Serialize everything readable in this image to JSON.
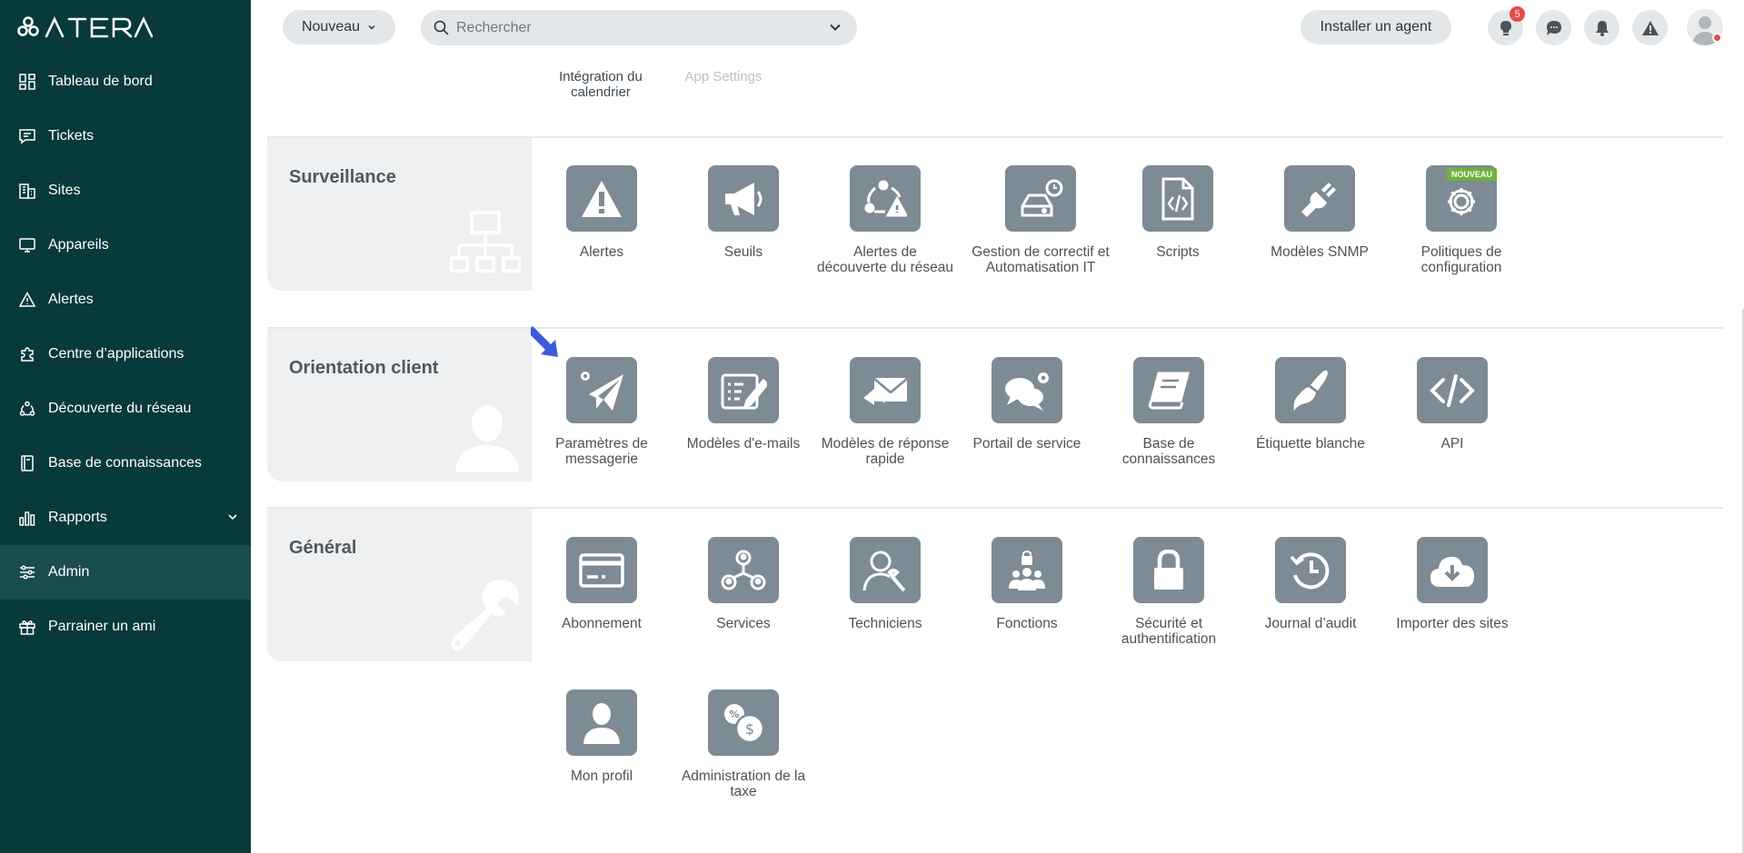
{
  "app": {
    "brand": "ATERA"
  },
  "sidebar": {
    "items": [
      {
        "label": "Tableau de bord",
        "icon": "dashboard-icon"
      },
      {
        "label": "Tickets",
        "icon": "ticket-icon"
      },
      {
        "label": "Sites",
        "icon": "building-icon"
      },
      {
        "label": "Appareils",
        "icon": "monitor-icon"
      },
      {
        "label": "Alertes",
        "icon": "warning-icon"
      },
      {
        "label": "Centre d’applications",
        "icon": "puzzle-icon"
      },
      {
        "label": "Découverte du réseau",
        "icon": "network-icon"
      },
      {
        "label": "Base de connaissances",
        "icon": "book-icon"
      },
      {
        "label": "Rapports",
        "icon": "chart-icon"
      },
      {
        "label": "Admin",
        "icon": "sliders-icon"
      },
      {
        "label": "Parrainer un ami",
        "icon": "gift-icon"
      }
    ]
  },
  "topbar": {
    "new_label": "Nouveau",
    "search_placeholder": "Rechercher",
    "install_agent_label": "Installer un agent",
    "ideas_badge": "5"
  },
  "top_links": {
    "calendar": "Intégration du calendrier",
    "app_settings": "App Settings"
  },
  "sections": {
    "surveillance": {
      "title": "Surveillance",
      "tiles": [
        {
          "label": "Alertes",
          "icon": "warning-icon"
        },
        {
          "label": "Seuils",
          "icon": "megaphone-icon"
        },
        {
          "label": "Alertes de découverte du réseau",
          "icon": "network-alert-icon"
        },
        {
          "label": "Gestion de correctif et Automatisation IT",
          "icon": "patch-icon"
        },
        {
          "label": "Scripts",
          "icon": "script-icon"
        },
        {
          "label": "Modèles SNMP",
          "icon": "plug-icon"
        },
        {
          "label": "Politiques de configuration",
          "icon": "gear-icon",
          "tag": "NOUVEAU"
        }
      ]
    },
    "orientation": {
      "title": "Orientation client",
      "tiles": [
        {
          "label": "Paramètres de messagerie",
          "icon": "send-settings-icon"
        },
        {
          "label": "Modèles d'e-mails",
          "icon": "email-template-icon"
        },
        {
          "label": "Modèles de réponse rapide",
          "icon": "quick-reply-icon"
        },
        {
          "label": "Portail de service",
          "icon": "chat-settings-icon"
        },
        {
          "label": "Base de connaissances",
          "icon": "book-icon"
        },
        {
          "label": "Étiquette blanche",
          "icon": "brush-icon"
        },
        {
          "label": "API",
          "icon": "code-icon"
        }
      ]
    },
    "general": {
      "title": "Général",
      "tiles": [
        {
          "label": "Abonnement",
          "icon": "credit-card-icon"
        },
        {
          "label": "Services",
          "icon": "services-icon"
        },
        {
          "label": "Techniciens",
          "icon": "technician-icon"
        },
        {
          "label": "Fonctions",
          "icon": "roles-icon"
        },
        {
          "label": "Sécurité et authentification",
          "icon": "lock-icon"
        },
        {
          "label": "Journal d’audit",
          "icon": "history-icon"
        },
        {
          "label": "Importer des sites",
          "icon": "cloud-download-icon"
        },
        {
          "label": "Mon profil",
          "icon": "user-icon"
        },
        {
          "label": "Administration de la taxe",
          "icon": "tax-icon"
        }
      ]
    }
  },
  "colors": {
    "sidebar_bg": "#08393b",
    "tile_bg": "#7d8b95",
    "accent": "#6fb23a",
    "pointer": "#3b5bdb"
  }
}
